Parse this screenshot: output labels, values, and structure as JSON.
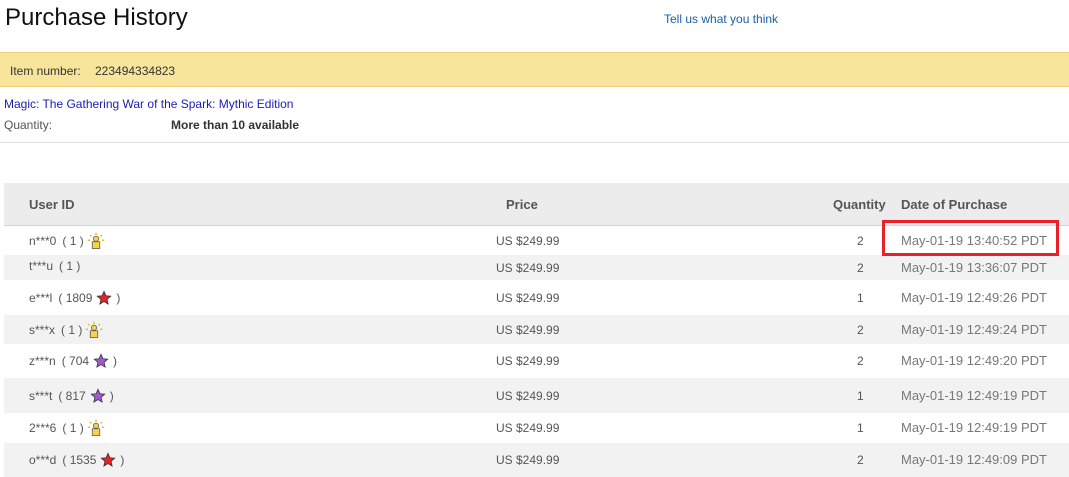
{
  "page": {
    "title": "Purchase History",
    "feedback_link": "Tell us what you think"
  },
  "item_bar": {
    "label": "Item number:",
    "value": "223494334823"
  },
  "item": {
    "title": "Magic: The Gathering War of the Spark: Mythic Edition",
    "quantity_label": "Quantity:",
    "quantity_value": "More than 10 available"
  },
  "table": {
    "columns": {
      "user_id": "User ID",
      "price": "Price",
      "quantity": "Quantity",
      "date": "Date of Purchase"
    },
    "rows": [
      {
        "user": "n***0",
        "score": "( 1 )",
        "badge": "new-user-icon",
        "price": "US $249.99",
        "quantity": "2",
        "date": "May-01-19 13:40:52 PDT"
      },
      {
        "user": "t***u",
        "score": "( 1 )",
        "badge": "",
        "price": "US $249.99",
        "quantity": "2",
        "date": "May-01-19 13:36:07 PDT"
      },
      {
        "user": "e***l",
        "score": "( 1809",
        "badge": "red-star-icon",
        "badge_color": "#e0262b",
        "price": "US $249.99",
        "quantity": "1",
        "date": "May-01-19 12:49:26 PDT"
      },
      {
        "user": "s***x",
        "score": "( 1 )",
        "badge": "new-user-icon",
        "price": "US $249.99",
        "quantity": "2",
        "date": "May-01-19 12:49:24 PDT"
      },
      {
        "user": "z***n",
        "score": "( 704",
        "badge": "purple-star-icon",
        "badge_color": "#a05ad1",
        "price": "US $249.99",
        "quantity": "2",
        "date": "May-01-19 12:49:20 PDT"
      },
      {
        "user": "s***t",
        "score": "( 817",
        "badge": "purple-star-icon",
        "badge_color": "#a05ad1",
        "price": "US $249.99",
        "quantity": "1",
        "date": "May-01-19 12:49:19 PDT"
      },
      {
        "user": "2***6",
        "score": "( 1 )",
        "badge": "new-user-icon",
        "price": "US $249.99",
        "quantity": "1",
        "date": "May-01-19 12:49:19 PDT"
      },
      {
        "user": "o***d",
        "score": "( 1535",
        "badge": "red-star-icon",
        "badge_color": "#e0262b",
        "price": "US $249.99",
        "quantity": "2",
        "date": "May-01-19 12:49:09 PDT"
      }
    ]
  },
  "colors": {
    "item_bar_bg": "#f6e59a",
    "highlight": "#e8212a",
    "link": "#1c1cb0"
  }
}
